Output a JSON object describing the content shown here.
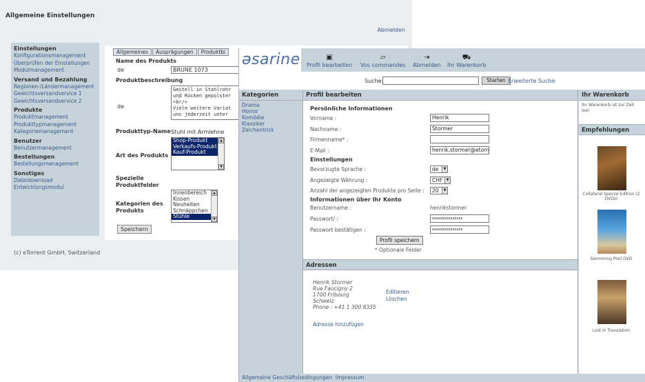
{
  "admin": {
    "title": "Allgemeine Einstellungen",
    "logout": "Abmelden",
    "sidebar": [
      {
        "section": "Einstellungen",
        "items": [
          "Konfigurationsmanagement",
          "Überprüfen der Einstellungen",
          "Modulmanagement"
        ]
      },
      {
        "section": "Versand und Bezahlung",
        "items": [
          "Regionen-/Ländermanagement",
          "Gewichtsversandservice 1",
          "Gewichtsversandservice 2"
        ]
      },
      {
        "section": "Produkte",
        "items": [
          "Produktmanagement",
          "Produkttypmanagement",
          "Kategoriemanagement"
        ]
      },
      {
        "section": "Benutzer",
        "items": [
          "Benutzermanagement"
        ]
      },
      {
        "section": "Bestellungen",
        "items": [
          "Bestellungsmanagement"
        ]
      },
      {
        "section": "Sonstiges",
        "items": [
          "Dateidownload",
          "Entwicklungsmodul"
        ]
      }
    ],
    "tabs": [
      "Allgemeines",
      "Ausprägungen",
      "Produktbi"
    ],
    "form": {
      "name_label": "Name des Produkts",
      "lang": "de",
      "name_value": "BRUNE 1073",
      "desc_label": "Produktbeschreibung",
      "desc_text": "Gestell in Stahlrohr\nund Rücken gepolster\n<br/>\nViele weitere Variat\nuns jederzeit unter",
      "type_label": "Produkttyp-Name",
      "type_value": "Stuhl mit Armlehne",
      "kind_label": "Art des Produkts",
      "kind_options": [
        "Shop-Produkt",
        "Verkaufs-Produkt",
        "Kauf-Produkt"
      ],
      "special_label": "Spezielle Produktfelder",
      "cat_label": "Kategorien des Produkts",
      "cat_options": [
        "Innenbereich",
        "Kissen",
        "Neuheiten",
        "Schnäppchen",
        "Stühle"
      ],
      "save": "Speichern"
    },
    "footer": "(c) eTorrent GmbH, Switzerland"
  },
  "shop": {
    "logo": "əsarine",
    "nav": [
      {
        "label": "Profil bearbeiten",
        "icon": "profile-card-icon"
      },
      {
        "label": "Vos commandes",
        "icon": "orders-icon"
      },
      {
        "label": "Abmelden",
        "icon": "logout-icon"
      },
      {
        "label": "Ihr Warenkorb",
        "icon": "cart-icon"
      }
    ],
    "search": {
      "label": "Suche:",
      "button": "Starten",
      "advanced": "Erweiterte Suche",
      "value": ""
    },
    "categories": {
      "title": "Kategorien",
      "items": [
        "Drama",
        "Horror",
        "Komödie",
        "Klassiker",
        "Zeichentrick"
      ]
    },
    "profile": {
      "title": "Profil bearbeiten",
      "personal_title": "Persönliche Informationen",
      "fields": [
        {
          "label": "Vorname :",
          "value": "Henrik"
        },
        {
          "label": "Nachname :",
          "value": "Stormer"
        },
        {
          "label": "Firmenname* :",
          "value": ""
        },
        {
          "label": "E-Mail :",
          "value": "henrik.stormer@etorren"
        }
      ],
      "settings_title": "Einstellungen",
      "settings": [
        {
          "label": "Bevorzugte Sprache :",
          "value": "de"
        },
        {
          "label": "Angezeigte Währung :",
          "value": "CHF"
        },
        {
          "label": "Anzahl der angezeigten Produkte pro Seite :",
          "value": "20"
        }
      ],
      "account_title": "Informationen über Ihr Konto",
      "username_label": "Benutzername :",
      "username_value": "henrikstormer",
      "password_label": "Passwort/ :",
      "password_value": "xxxxxxxxxxxxxxx",
      "confirm_label": "Passwort bestätigen :",
      "confirm_value": "xxxxxxxxxxxxxxx",
      "save": "Profil speichern",
      "optional_note": "* Optionale Felder"
    },
    "addresses": {
      "title": "Adressen",
      "address_lines": [
        "Henrik Stormer",
        "Rue Faucigny 2",
        "1700 Fribourg",
        "Schweiz",
        "Phone : +41 1 300 8335"
      ],
      "edit": "Editieren",
      "delete": "Löschen",
      "add": "Adresse hinzufügen"
    },
    "cart": {
      "title": "Ihr Warenkorb",
      "empty": "Ihr Warenkorb ist zur Zeit leer."
    },
    "recommendations": {
      "title": "Empfehlungen",
      "items": [
        {
          "caption": "Collateral Special Edition (2 DVDs)"
        },
        {
          "caption": "Swimming Pool DVD"
        },
        {
          "caption": "Lost in Translation"
        }
      ]
    },
    "footer": {
      "terms": "Allgemeine Geschäftsbedingungen",
      "imprint": "Impressum"
    }
  }
}
